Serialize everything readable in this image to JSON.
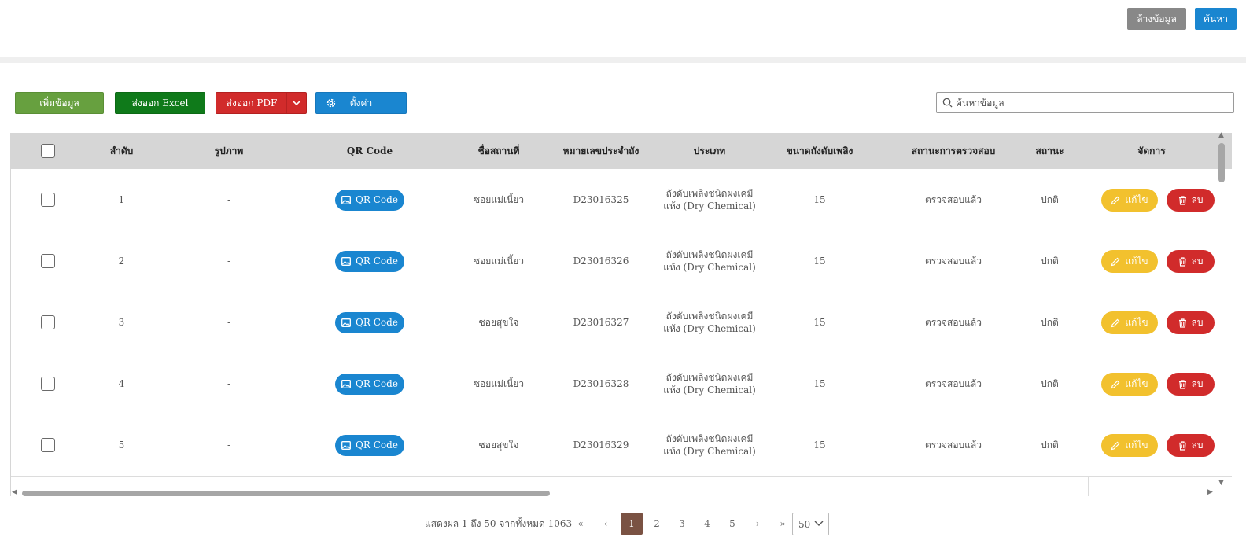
{
  "top_actions": {
    "clear_label": "ล้างข้อมูล",
    "search_label": "ค้นหา"
  },
  "toolbar": {
    "add_label": "เพิ่มข้อมูล",
    "export_excel_label": "ส่งออก Excel",
    "export_pdf_label": "ส่งออก PDF",
    "settings_label": "ตั้งค่า",
    "search_placeholder": "ค้นหาข้อมูล"
  },
  "table": {
    "columns": [
      "ลำดับ",
      "รูปภาพ",
      "QR Code",
      "ชื่อสถานที่",
      "หมายเลขประจำถัง",
      "ประเภท",
      "ขนาดถังดับเพลิง",
      "สถานะการตรวจสอบ",
      "สถานะ",
      "จัดการ"
    ],
    "qr_label": "QR Code",
    "edit_label": "แก้ไข",
    "delete_label": "ลบ",
    "rows": [
      {
        "no": "1",
        "image": "-",
        "place": "ซอยแม่เนี้ยว",
        "serial": "D23016325",
        "type": "ถังดับเพลิงชนิดผงเคมีแห้ง (Dry Chemical)",
        "size": "15",
        "inspection": "ตรวจสอบแล้ว",
        "status": "ปกติ"
      },
      {
        "no": "2",
        "image": "-",
        "place": "ซอยแม่เนี้ยว",
        "serial": "D23016326",
        "type": "ถังดับเพลิงชนิดผงเคมีแห้ง (Dry Chemical)",
        "size": "15",
        "inspection": "ตรวจสอบแล้ว",
        "status": "ปกติ"
      },
      {
        "no": "3",
        "image": "-",
        "place": "ซอยสุขใจ",
        "serial": "D23016327",
        "type": "ถังดับเพลิงชนิดผงเคมีแห้ง (Dry Chemical)",
        "size": "15",
        "inspection": "ตรวจสอบแล้ว",
        "status": "ปกติ"
      },
      {
        "no": "4",
        "image": "-",
        "place": "ซอยแม่เนี้ยว",
        "serial": "D23016328",
        "type": "ถังดับเพลิงชนิดผงเคมีแห้ง (Dry Chemical)",
        "size": "15",
        "inspection": "ตรวจสอบแล้ว",
        "status": "ปกติ"
      },
      {
        "no": "5",
        "image": "-",
        "place": "ซอยสุขใจ",
        "serial": "D23016329",
        "type": "ถังดับเพลิงชนิดผงเคมีแห้ง (Dry Chemical)",
        "size": "15",
        "inspection": "ตรวจสอบแล้ว",
        "status": "ปกติ"
      }
    ]
  },
  "pagination": {
    "summary": "แสดงผล 1 ถึง 50 จากทั้งหมด 1063",
    "first": "«",
    "prev": "‹",
    "pages": [
      "1",
      "2",
      "3",
      "4",
      "5"
    ],
    "active_page": "1",
    "next": "›",
    "last": "»",
    "page_size": "50"
  },
  "colors": {
    "add": "#67a03f",
    "excel": "#0f7a1a",
    "pdf": "#d12b2b",
    "settings": "#1a86d0",
    "edit": "#f2c12e",
    "delete": "#d12b2b",
    "header_bg": "#d6d6d6",
    "active_page": "#7a5243"
  }
}
